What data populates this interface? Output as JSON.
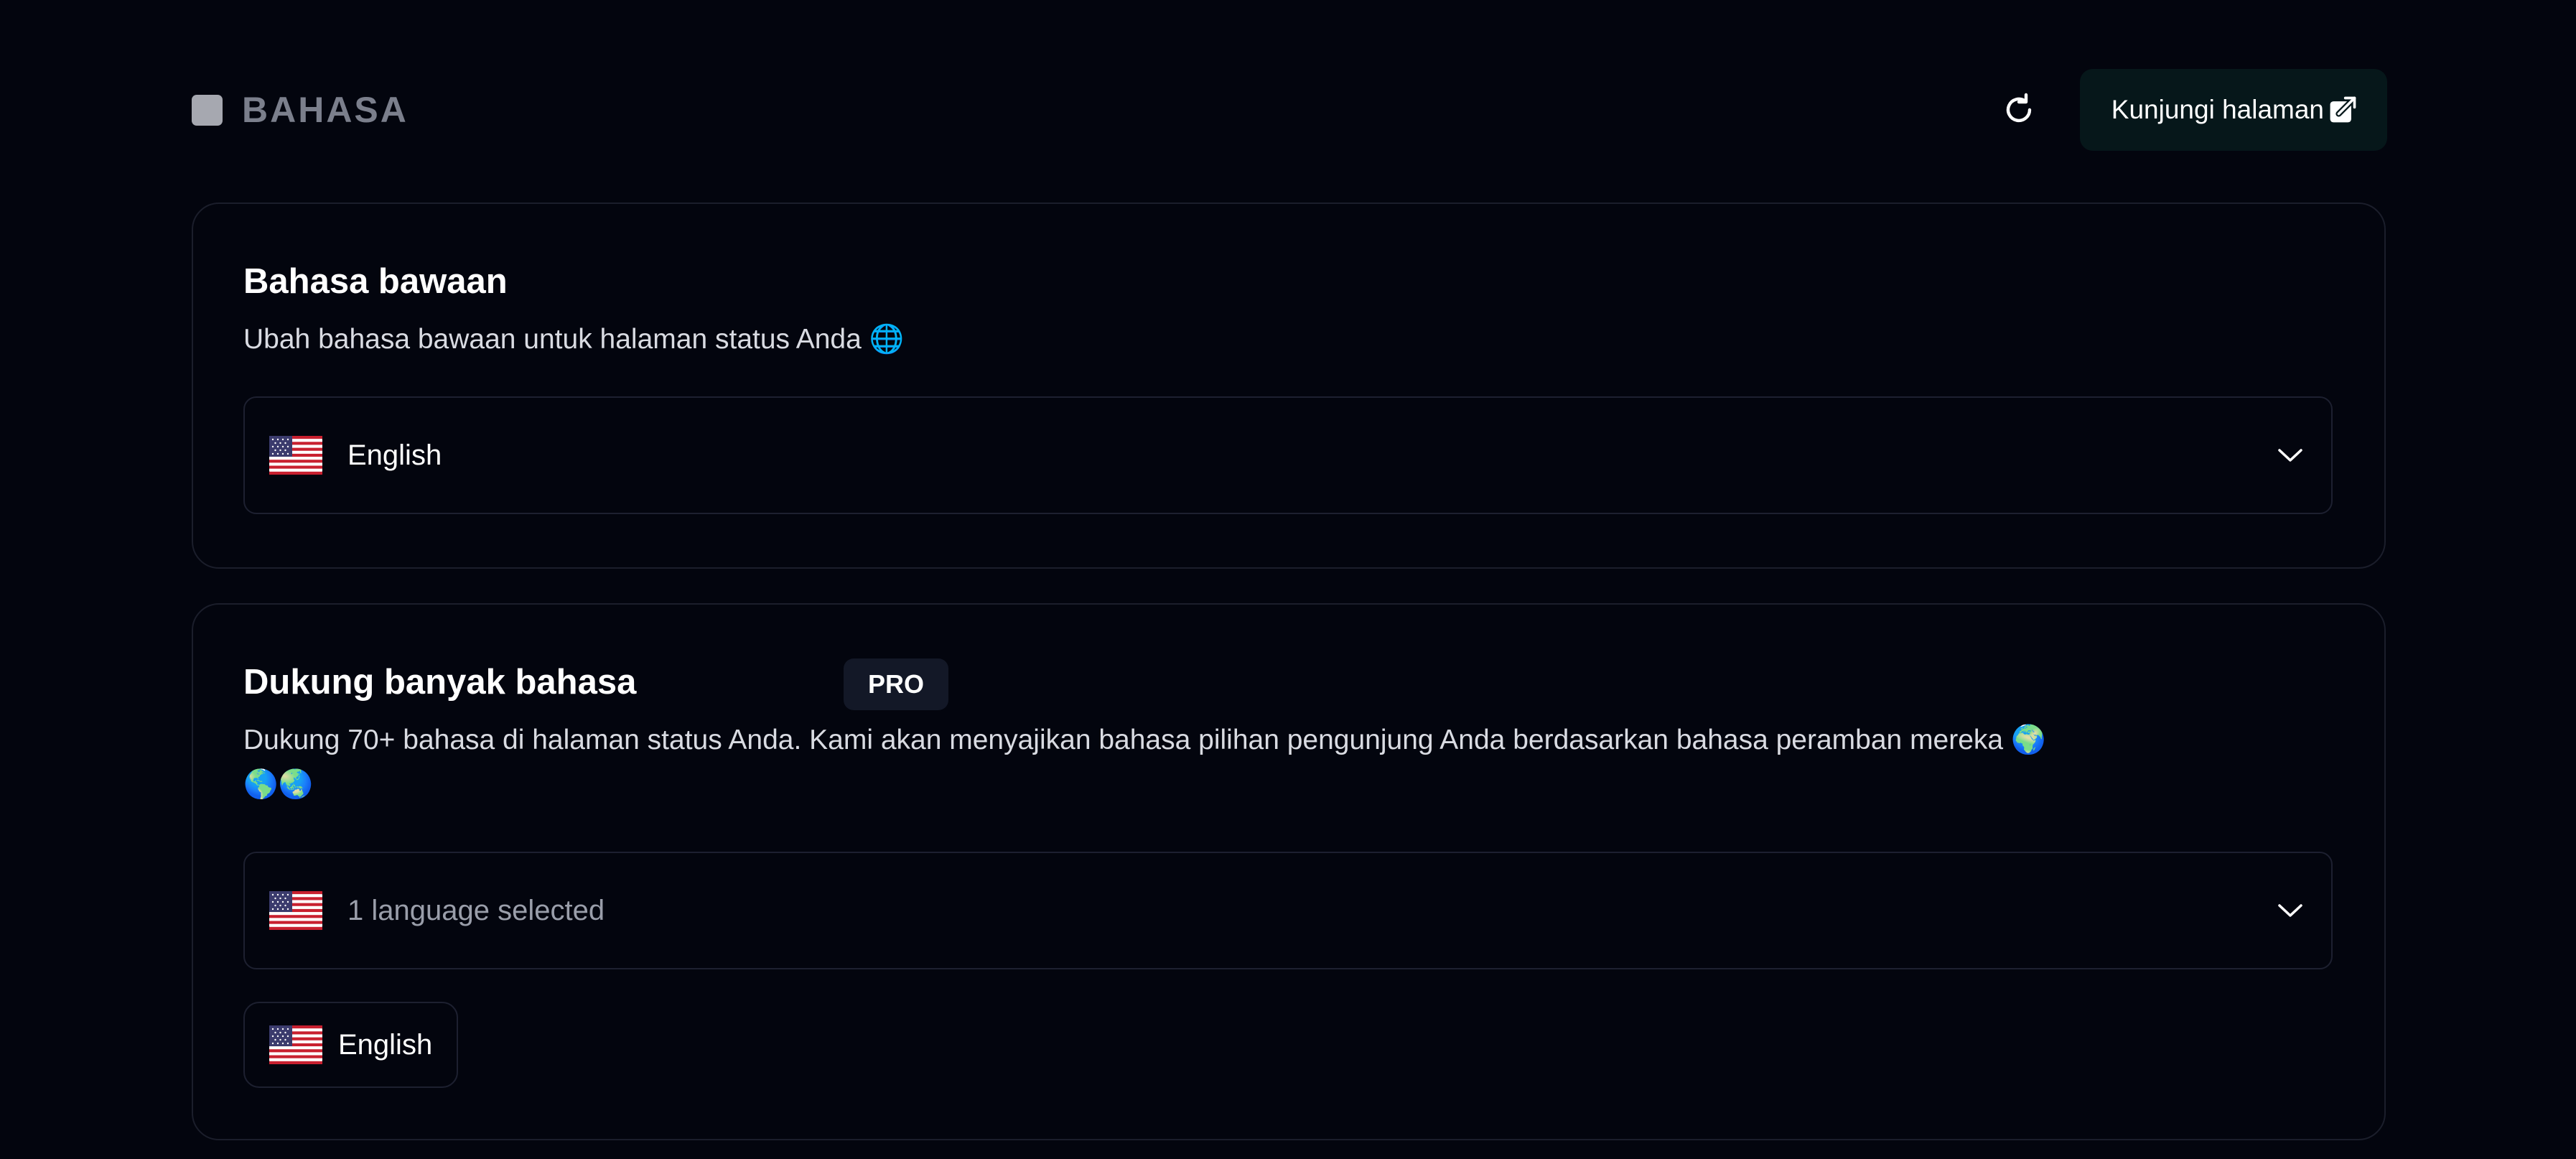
{
  "header": {
    "title": "BAHASA",
    "visit_label": "Kunjungi halaman",
    "icons": [
      "refresh-icon",
      "external-link-icon"
    ]
  },
  "default_language": {
    "title": "Bahasa bawaan",
    "description": "Ubah bahasa bawaan untuk halaman status Anda 🌐",
    "selected": "English",
    "selected_flag": "us-flag-icon"
  },
  "multi_language": {
    "title": "Dukung banyak bahasa",
    "badge": "PRO",
    "description_line1": "Dukung 70+ bahasa di halaman status Anda. Kami akan menyajikan bahasa pilihan pengunjung Anda berdasarkan bahasa peramban mereka 🌍",
    "description_line2": "🌎🌏",
    "select_placeholder": "1 language selected",
    "chips": [
      {
        "label": "English",
        "flag": "us-flag-icon"
      }
    ]
  },
  "colors": {
    "background": "#03050e",
    "card_border": "#1b1e2b",
    "visit_button_bg": "#06171a",
    "badge_bg": "#131827",
    "muted_text": "#7b7f8c"
  }
}
